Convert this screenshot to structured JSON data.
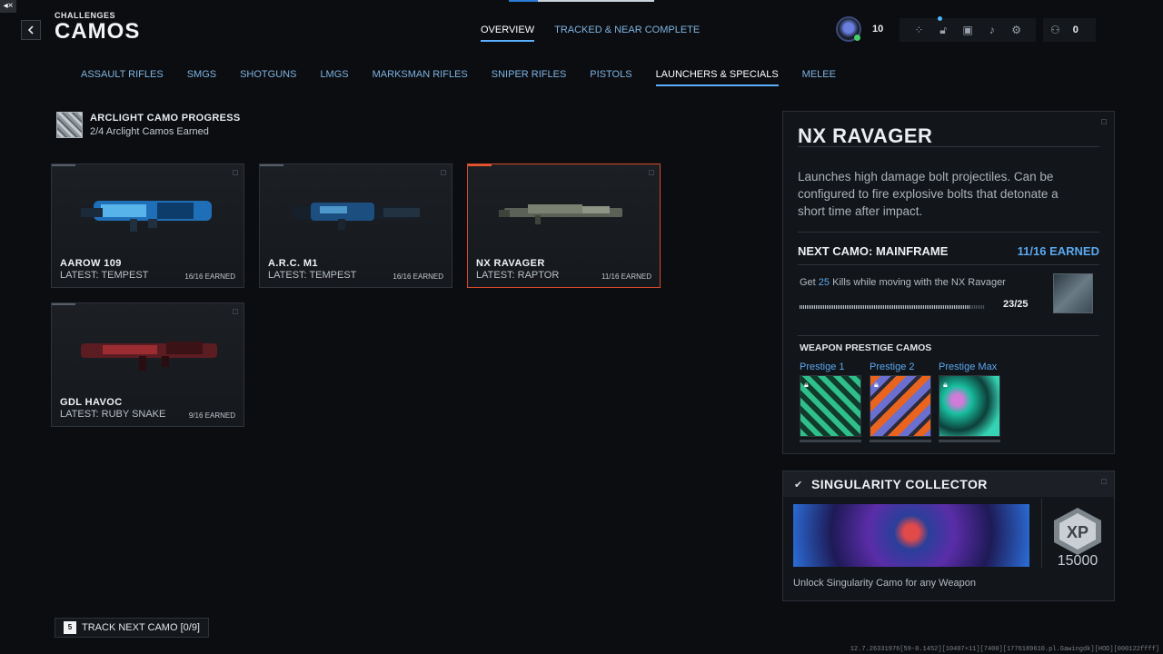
{
  "header": {
    "breadcrumb": "CHALLENGES",
    "title": "CAMOS",
    "tabs": [
      {
        "label": "OVERVIEW",
        "active": true
      },
      {
        "label": "TRACKED & NEAR COMPLETE",
        "active": false
      }
    ],
    "player_level": "10",
    "players_online": "0"
  },
  "categories": [
    {
      "label": "ASSAULT RIFLES",
      "active": false
    },
    {
      "label": "SMGS",
      "active": false
    },
    {
      "label": "SHOTGUNS",
      "active": false
    },
    {
      "label": "LMGS",
      "active": false
    },
    {
      "label": "MARKSMAN RIFLES",
      "active": false
    },
    {
      "label": "SNIPER RIFLES",
      "active": false
    },
    {
      "label": "PISTOLS",
      "active": false
    },
    {
      "label": "LAUNCHERS & SPECIALS",
      "active": true
    },
    {
      "label": "MELEE",
      "active": false
    }
  ],
  "arclight": {
    "title": "ARCLIGHT CAMO PROGRESS",
    "subtitle": "2/4 Arclight Camos Earned"
  },
  "weapons": [
    {
      "name": "AAROW 109",
      "latest": "LATEST: TEMPEST",
      "earned": "16/16 EARNED",
      "selected": false
    },
    {
      "name": "A.R.C. M1",
      "latest": "LATEST: TEMPEST",
      "earned": "16/16 EARNED",
      "selected": false
    },
    {
      "name": "NX RAVAGER",
      "latest": "LATEST: RAPTOR",
      "earned": "11/16 EARNED",
      "selected": true
    },
    {
      "name": "GDL HAVOC",
      "latest": "LATEST: RUBY SNAKE",
      "earned": "9/16 EARNED",
      "selected": false
    }
  ],
  "detail": {
    "title": "NX RAVAGER",
    "description": "Launches high damage bolt projectiles. Can be configured to fire explosive bolts that detonate a short time after impact.",
    "next_camo_label": "NEXT CAMO: MAINFRAME",
    "next_camo_earned": "11/16 EARNED",
    "challenge_prefix": "Get ",
    "challenge_count": "25",
    "challenge_suffix": " Kills while moving with the NX Ravager",
    "progress_text": "23/25",
    "progress_fraction": 0.92,
    "prestige_header": "WEAPON PRESTIGE CAMOS",
    "prestige": [
      {
        "label": "Prestige 1",
        "icon": "lock-icon"
      },
      {
        "label": "Prestige 2",
        "icon": "lock-icon"
      },
      {
        "label": "Prestige Max",
        "icon": "lock-icon"
      }
    ]
  },
  "singularity": {
    "title": "SINGULARITY COLLECTOR",
    "xp_label": "XP",
    "xp_value": "15000",
    "description": "Unlock Singularity Camo for any Weapon"
  },
  "footer": {
    "track_key": "5",
    "track_label": "TRACK NEXT CAMO [0/9]",
    "build_info": "12.7.26331976[59-0.1452][10407+11][7400][1776189610.pl.Gawingdk][HOD][000122ffff]"
  },
  "colors": {
    "accent_blue": "#5aa8f0",
    "selected_border": "#d54b2a",
    "background": "#0b0d10"
  }
}
